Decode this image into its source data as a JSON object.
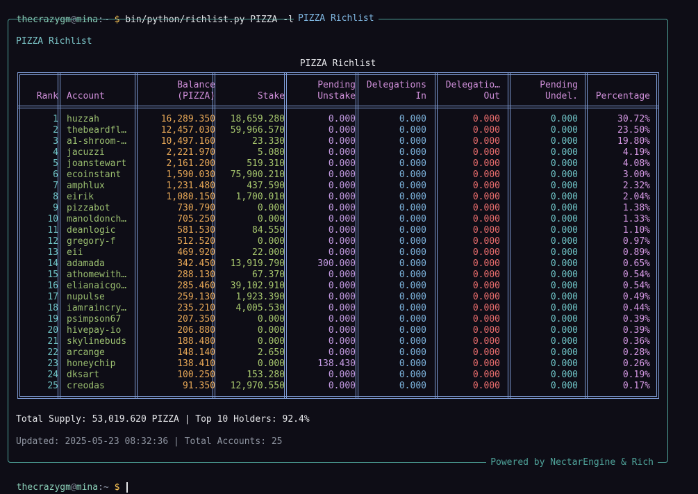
{
  "terminal": {
    "top_prompt": {
      "user": "thecrazygm",
      "at": "@",
      "host": "mina",
      "path": ":~",
      "sigil": "$",
      "command": "bin/python/richlist.py PIZZA -l 25"
    },
    "bottom_prompt": {
      "user": "thecrazygm",
      "at": "@",
      "host": "mina",
      "path": ":~",
      "sigil": "$",
      "command": ""
    }
  },
  "panel": {
    "title": "PIZZA Richlist",
    "heading": "PIZZA Richlist",
    "footer": "Powered by NectarEngine & Rich",
    "summary": "Total Supply: 53,019.620 PIZZA | Top 10 Holders: 92.4%",
    "updated": "Updated: 2025-05-23 08:32:36 | Total Accounts: 25"
  },
  "table": {
    "title": "PIZZA Richlist",
    "headers": [
      {
        "key": "rank",
        "label": "Rank"
      },
      {
        "key": "account",
        "label": "Account"
      },
      {
        "key": "balance",
        "label": "Balance\n(PIZZA)"
      },
      {
        "key": "stake",
        "label": "Stake"
      },
      {
        "key": "pending_unstake",
        "label": "Pending\nUnstake"
      },
      {
        "key": "delegations_in",
        "label": "Delegations\nIn"
      },
      {
        "key": "delegations_out",
        "label": "Delegatio…\nOut"
      },
      {
        "key": "pending_undel",
        "label": "Pending\nUndel."
      },
      {
        "key": "percentage",
        "label": "Percentage"
      }
    ],
    "rows": [
      [
        "1",
        "huzzah",
        "16,289.350",
        "18,659.280",
        "0.000",
        "0.000",
        "0.000",
        "0.000",
        "30.72%"
      ],
      [
        "2",
        "thebeardfl…",
        "12,457.030",
        "59,966.570",
        "0.000",
        "0.000",
        "0.000",
        "0.000",
        "23.50%"
      ],
      [
        "3",
        "a1-shroom-…",
        "10,497.160",
        "23.330",
        "0.000",
        "0.000",
        "0.000",
        "0.000",
        "19.80%"
      ],
      [
        "4",
        "jacuzzi",
        "2,221.970",
        "5.080",
        "0.000",
        "0.000",
        "0.000",
        "0.000",
        "4.19%"
      ],
      [
        "5",
        "joanstewart",
        "2,161.200",
        "519.310",
        "0.000",
        "0.000",
        "0.000",
        "0.000",
        "4.08%"
      ],
      [
        "6",
        "ecoinstant",
        "1,590.030",
        "75,900.210",
        "0.000",
        "0.000",
        "0.000",
        "0.000",
        "3.00%"
      ],
      [
        "7",
        "amphlux",
        "1,231.480",
        "437.590",
        "0.000",
        "0.000",
        "0.000",
        "0.000",
        "2.32%"
      ],
      [
        "8",
        "eirik",
        "1,080.150",
        "1,700.010",
        "0.000",
        "0.000",
        "0.000",
        "0.000",
        "2.04%"
      ],
      [
        "9",
        "pizzabot",
        "730.790",
        "0.000",
        "0.000",
        "0.000",
        "0.000",
        "0.000",
        "1.38%"
      ],
      [
        "10",
        "manoldonch…",
        "705.250",
        "0.000",
        "0.000",
        "0.000",
        "0.000",
        "0.000",
        "1.33%"
      ],
      [
        "11",
        "deanlogic",
        "581.530",
        "84.550",
        "0.000",
        "0.000",
        "0.000",
        "0.000",
        "1.10%"
      ],
      [
        "12",
        "gregory-f",
        "512.520",
        "0.000",
        "0.000",
        "0.000",
        "0.000",
        "0.000",
        "0.97%"
      ],
      [
        "13",
        "eii",
        "469.920",
        "22.000",
        "0.000",
        "0.000",
        "0.000",
        "0.000",
        "0.89%"
      ],
      [
        "14",
        "adamada",
        "342.450",
        "13,919.790",
        "300.000",
        "0.000",
        "0.000",
        "0.000",
        "0.65%"
      ],
      [
        "15",
        "athomewith…",
        "288.130",
        "67.370",
        "0.000",
        "0.000",
        "0.000",
        "0.000",
        "0.54%"
      ],
      [
        "16",
        "elianaicgo…",
        "285.460",
        "39,102.910",
        "0.000",
        "0.000",
        "0.000",
        "0.000",
        "0.54%"
      ],
      [
        "17",
        "nupulse",
        "259.130",
        "1,923.390",
        "0.000",
        "0.000",
        "0.000",
        "0.000",
        "0.49%"
      ],
      [
        "18",
        "iamraincry…",
        "235.210",
        "4,005.530",
        "0.000",
        "0.000",
        "0.000",
        "0.000",
        "0.44%"
      ],
      [
        "19",
        "psimpson67",
        "207.350",
        "0.000",
        "0.000",
        "0.000",
        "0.000",
        "0.000",
        "0.39%"
      ],
      [
        "20",
        "hivepay-io",
        "206.880",
        "0.000",
        "0.000",
        "0.000",
        "0.000",
        "0.000",
        "0.39%"
      ],
      [
        "21",
        "skylinebuds",
        "188.480",
        "0.000",
        "0.000",
        "0.000",
        "0.000",
        "0.000",
        "0.36%"
      ],
      [
        "22",
        "arcange",
        "148.140",
        "2.650",
        "0.000",
        "0.000",
        "0.000",
        "0.000",
        "0.28%"
      ],
      [
        "23",
        "honeychip",
        "138.410",
        "0.000",
        "138.430",
        "0.000",
        "0.000",
        "0.000",
        "0.26%"
      ],
      [
        "24",
        "dksart",
        "100.250",
        "153.280",
        "0.000",
        "0.000",
        "0.000",
        "0.000",
        "0.19%"
      ],
      [
        "25",
        "creodas",
        "91.350",
        "12,970.550",
        "0.000",
        "0.000",
        "0.000",
        "0.000",
        "0.17%"
      ]
    ]
  }
}
